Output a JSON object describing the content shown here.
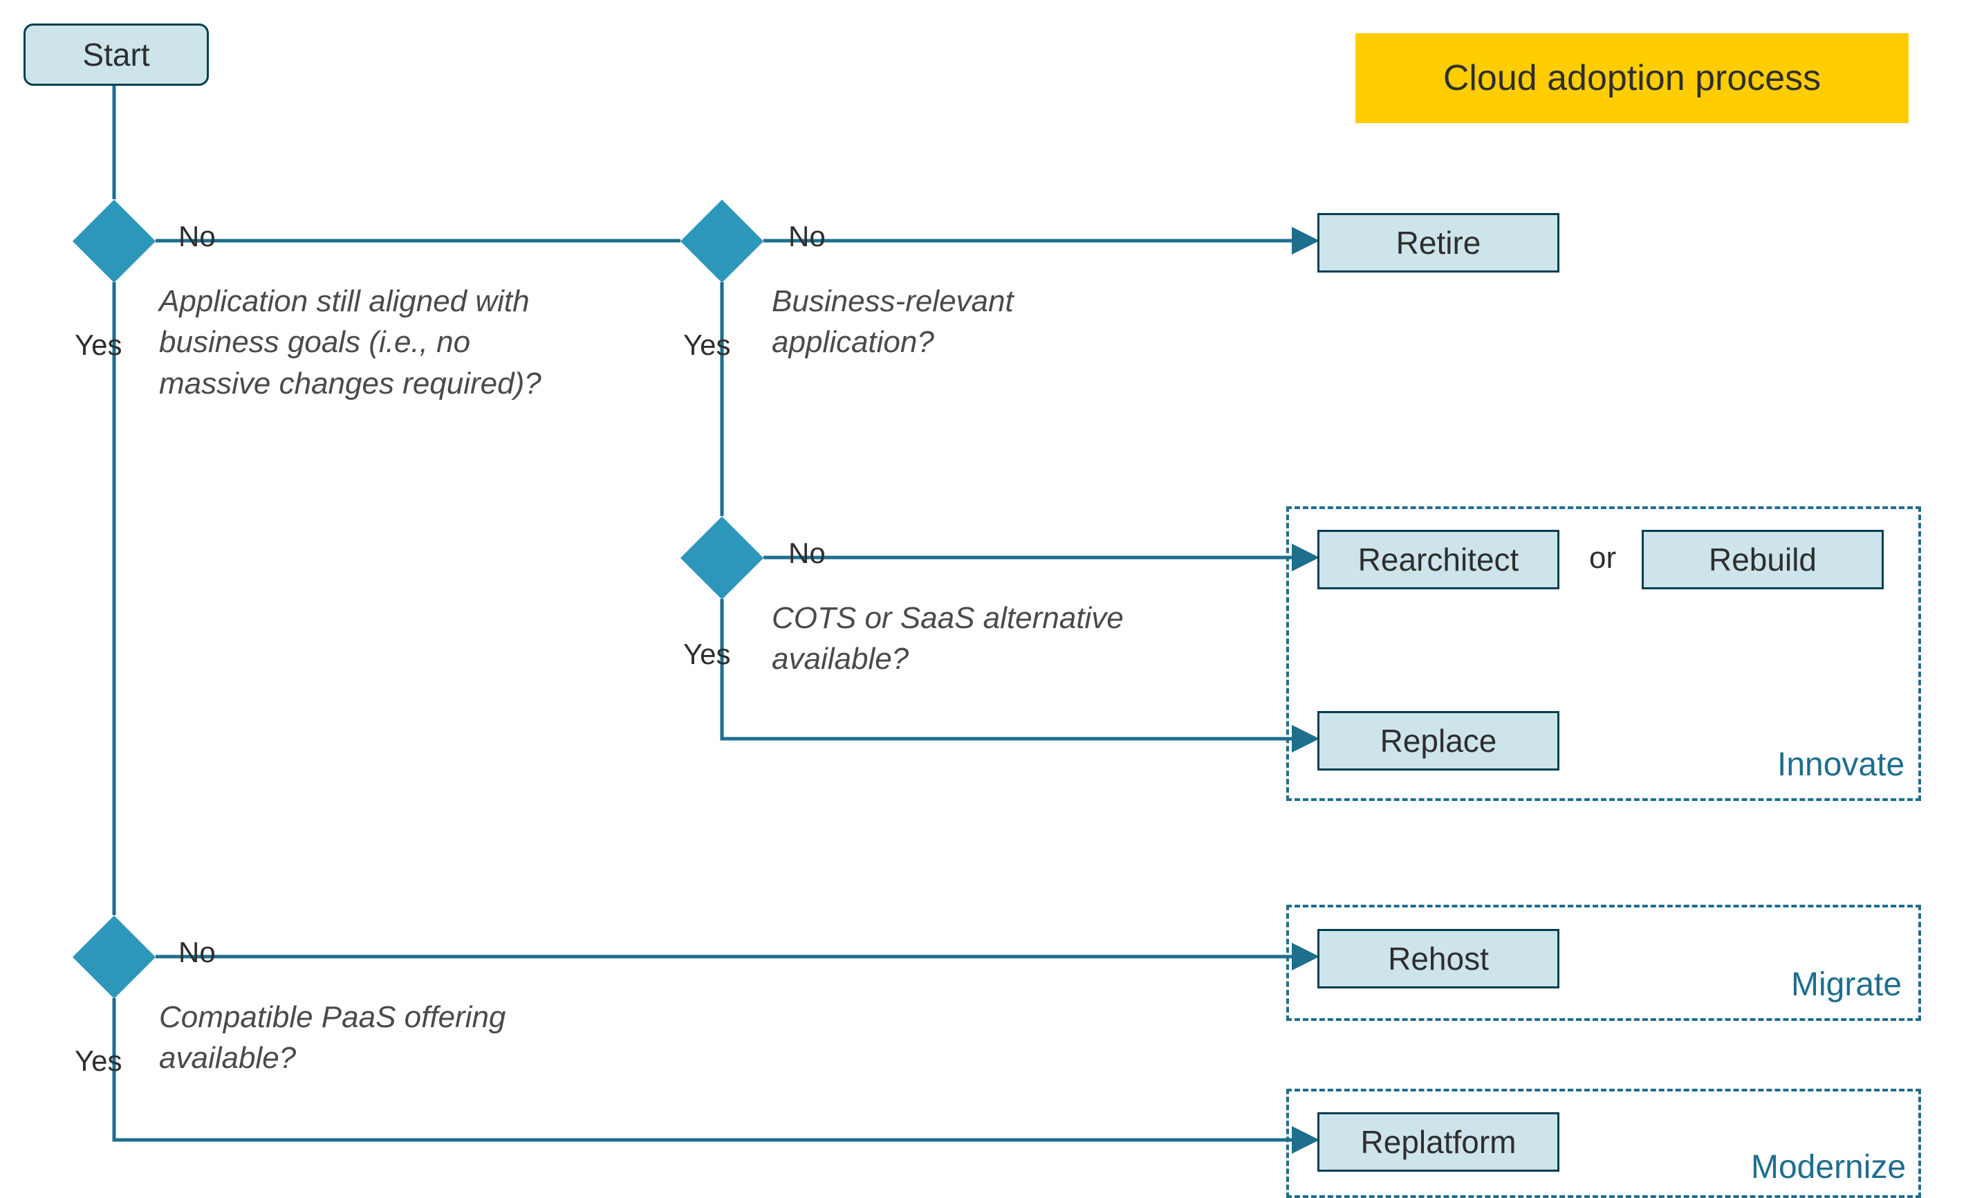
{
  "title": "Cloud adoption process",
  "nodes": {
    "start": "Start",
    "retire": "Retire",
    "rearchitect": "Rearchitect",
    "rebuild": "Rebuild",
    "replace": "Replace",
    "rehost": "Rehost",
    "replatform": "Replatform"
  },
  "decisions": {
    "d1": {
      "question": "Application still aligned with business goals (i.e., no massive changes required)?",
      "yes": "Yes",
      "no": "No"
    },
    "d2": {
      "question": "Business-relevant application?",
      "yes": "Yes",
      "no": "No"
    },
    "d3": {
      "question": "COTS or SaaS alternative available?",
      "yes": "Yes",
      "no": "No"
    },
    "d4": {
      "question": "Compatible PaaS offering available?",
      "yes": "Yes",
      "no": "No"
    }
  },
  "connector_or": "or",
  "groups": {
    "innovate": "Innovate",
    "migrate": "Migrate",
    "modernize": "Modernize"
  },
  "colors": {
    "line": "#1e6e8e",
    "diamond": "#2d97bb",
    "box_fill": "#cce4ea",
    "box_border": "#003e53",
    "title_bg": "#ffcd00"
  }
}
